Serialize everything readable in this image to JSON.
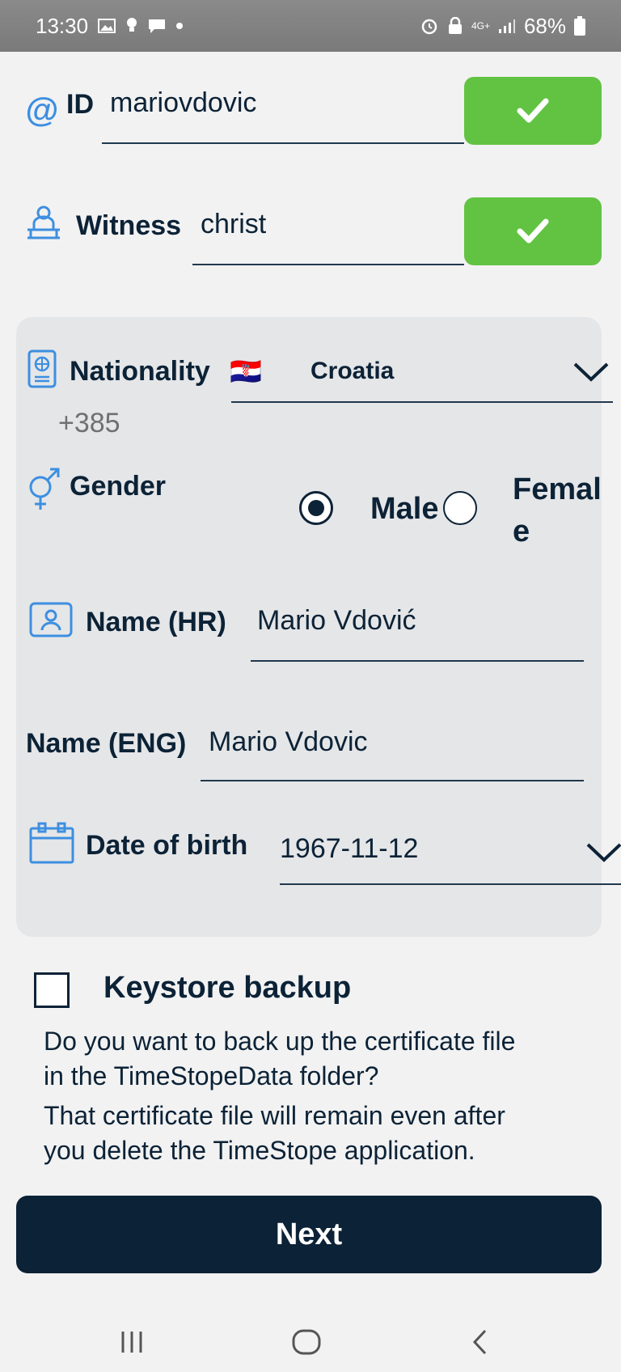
{
  "status_bar": {
    "time": "13:30",
    "battery": "68%",
    "network": "4G+"
  },
  "form": {
    "id_label": "ID",
    "id_value": "mariovdovic",
    "witness_label": "Witness",
    "witness_value": "christ",
    "nationality_label": "Nationality",
    "nationality_flag": "🇭🇷",
    "nationality_value": "Croatia",
    "phone_code": "+385",
    "gender_label": "Gender",
    "gender_male": "Male",
    "gender_female_line1": "Femal",
    "gender_female_line2": "e",
    "gender_selected": "male",
    "name_hr_label": "Name (HR)",
    "name_hr_value": "Mario Vdović",
    "name_eng_label": "Name (ENG)",
    "name_eng_value": "Mario Vdovic",
    "dob_label": "Date of birth",
    "dob_value": "1967-11-12"
  },
  "backup": {
    "title": "Keystore backup",
    "checked": false,
    "desc_line1": "Do you want to back up the certificate file",
    "desc_line2": "in the TimeStopeData folder?",
    "desc_line3": "That certificate file will remain even after",
    "desc_line4": "you delete the TimeStope application."
  },
  "next_button": "Next",
  "colors": {
    "accent_blue": "#3d8fe0",
    "check_green": "#62c343",
    "navy": "#0c2236",
    "card_bg": "#e5e6e8"
  },
  "icons": {
    "id": "at-sign-icon",
    "witness": "witness-person-icon",
    "nationality": "passport-icon",
    "gender": "gender-male-female-icon",
    "name": "user-id-card-icon",
    "dob": "calendar-icon"
  }
}
